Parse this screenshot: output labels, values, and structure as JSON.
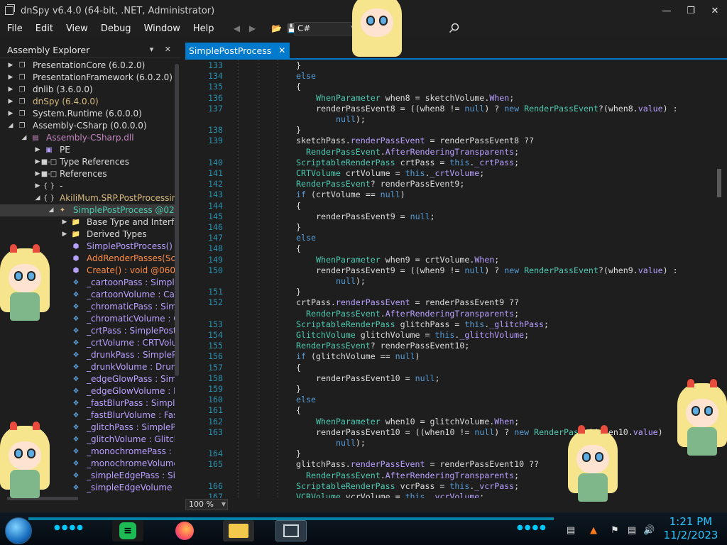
{
  "window": {
    "title": "dnSpy v6.4.0 (64-bit, .NET, Administrator)",
    "controls": [
      "minimize",
      "maximize",
      "close"
    ]
  },
  "menu": [
    "File",
    "Edit",
    "View",
    "Debug",
    "Window",
    "Help"
  ],
  "toolbar": {
    "language": "C#",
    "icons": [
      "back-icon",
      "forward-icon",
      "open-icon",
      "save-icon",
      "search-icon"
    ]
  },
  "explorer": {
    "title": "Assembly Explorer",
    "header_controls": "▾ ✕",
    "tree": [
      {
        "expand": "▶",
        "icon": "assembly",
        "label": "PresentationCore (6.0.2.0)",
        "color": "white",
        "indent": 0
      },
      {
        "expand": "▶",
        "icon": "assembly",
        "label": "PresentationFramework (6.0.2.0)",
        "color": "white",
        "indent": 0
      },
      {
        "expand": "▶",
        "icon": "assembly",
        "label": "dnlib (3.6.0.0)",
        "color": "white",
        "indent": 0
      },
      {
        "expand": "▶",
        "icon": "assembly",
        "label": "dnSpy (6.4.0.0)",
        "color": "yellow",
        "indent": 0
      },
      {
        "expand": "▶",
        "icon": "assembly",
        "label": "System.Runtime (6.0.0.0)",
        "color": "white",
        "indent": 0
      },
      {
        "expand": "◢",
        "icon": "assembly",
        "label": "Assembly-CSharp (0.0.0.0)",
        "color": "white",
        "indent": 0
      },
      {
        "expand": "◢",
        "icon": "module",
        "label": "Assembly-CSharp.dll",
        "color": "violet",
        "indent": 1
      },
      {
        "expand": "▶",
        "icon": "pe",
        "label": "PE",
        "color": "white",
        "indent": 2
      },
      {
        "expand": "▶",
        "icon": "ref",
        "label": "Type References",
        "color": "white",
        "indent": 2
      },
      {
        "expand": "▶",
        "icon": "ref",
        "label": "References",
        "color": "white",
        "indent": 2
      },
      {
        "expand": "▶",
        "icon": "ns",
        "label": "-",
        "color": "white",
        "indent": 2
      },
      {
        "expand": "◢",
        "icon": "ns",
        "label": "AkiliMum.SRP.PostProcessing",
        "color": "yellow",
        "indent": 2
      },
      {
        "expand": "◢",
        "icon": "class",
        "label": "SimplePostProcess @0200",
        "color": "teal",
        "indent": 3,
        "selected": true
      },
      {
        "expand": "▶",
        "icon": "folder",
        "label": "Base Type and Interfac",
        "color": "white",
        "indent": 4
      },
      {
        "expand": "▶",
        "icon": "folder",
        "label": "Derived Types",
        "color": "white",
        "indent": 4
      },
      {
        "expand": "",
        "icon": "method",
        "label": "SimplePostProcess() : v",
        "color": "purple",
        "indent": 4
      },
      {
        "expand": "",
        "icon": "method",
        "label": "AddRenderPasses(Scrip",
        "color": "orange",
        "indent": 4
      },
      {
        "expand": "",
        "icon": "method",
        "label": "Create() : void @06000",
        "color": "orange",
        "indent": 4
      },
      {
        "expand": "",
        "icon": "field",
        "label": "_cartoonPass : SimpleP",
        "color": "purple",
        "indent": 4
      },
      {
        "expand": "",
        "icon": "field",
        "label": "_cartoonVolume : Cart",
        "color": "purple",
        "indent": 4
      },
      {
        "expand": "",
        "icon": "field",
        "label": "_chromaticPass : Simp",
        "color": "purple",
        "indent": 4
      },
      {
        "expand": "",
        "icon": "field",
        "label": "_chromaticVolume : C",
        "color": "purple",
        "indent": 4
      },
      {
        "expand": "",
        "icon": "field",
        "label": "_crtPass : SimplePostP",
        "color": "purple",
        "indent": 4
      },
      {
        "expand": "",
        "icon": "field",
        "label": "_crtVolume : CRTVolun",
        "color": "purple",
        "indent": 4
      },
      {
        "expand": "",
        "icon": "field",
        "label": "_drunkPass : SimplePo",
        "color": "purple",
        "indent": 4
      },
      {
        "expand": "",
        "icon": "field",
        "label": "_drunkVolume : Drunk",
        "color": "purple",
        "indent": 4
      },
      {
        "expand": "",
        "icon": "field",
        "label": "_edgeGlowPass : Simp",
        "color": "purple",
        "indent": 4
      },
      {
        "expand": "",
        "icon": "field",
        "label": "_edgeGlowVolume : Ec",
        "color": "purple",
        "indent": 4
      },
      {
        "expand": "",
        "icon": "field",
        "label": "_fastBlurPass : SimpleP",
        "color": "purple",
        "indent": 4
      },
      {
        "expand": "",
        "icon": "field",
        "label": "_fastBlurVolume : Fastl",
        "color": "purple",
        "indent": 4
      },
      {
        "expand": "",
        "icon": "field",
        "label": "_glitchPass : SimplePo",
        "color": "purple",
        "indent": 4
      },
      {
        "expand": "",
        "icon": "field",
        "label": "_glitchVolume : GlitchV",
        "color": "purple",
        "indent": 4
      },
      {
        "expand": "",
        "icon": "field",
        "label": "_monochromePass : Si",
        "color": "purple",
        "indent": 4
      },
      {
        "expand": "",
        "icon": "field",
        "label": "_monochromeVolume",
        "color": "purple",
        "indent": 4
      },
      {
        "expand": "",
        "icon": "field",
        "label": "_simpleEdgePass : Sim",
        "color": "purple",
        "indent": 4
      },
      {
        "expand": "",
        "icon": "field",
        "label": "_simpleEdgeVolume : ",
        "color": "purple",
        "indent": 4
      }
    ]
  },
  "editor": {
    "tab_label": "SimplePostProcess",
    "zoom": "100 %",
    "lines": [
      {
        "n": "133",
        "i": 0,
        "code": [
          [
            "}",
            "n"
          ]
        ]
      },
      {
        "n": "134",
        "i": 0,
        "code": [
          [
            "else",
            "k"
          ]
        ]
      },
      {
        "n": "135",
        "i": 0,
        "code": [
          [
            "{",
            "n"
          ]
        ]
      },
      {
        "n": "136",
        "i": 1,
        "code": [
          [
            "WhenParameter",
            "t"
          ],
          [
            " when8 = sketchVolume.",
            "n"
          ],
          [
            "When",
            "p"
          ],
          [
            ";",
            "n"
          ]
        ]
      },
      {
        "n": "137",
        "i": 1,
        "code": [
          [
            "renderPassEvent8 = ((when8 != ",
            "n"
          ],
          [
            "null",
            "k"
          ],
          [
            ") ? ",
            "n"
          ],
          [
            "new",
            "k"
          ],
          [
            " ",
            "n"
          ],
          [
            "RenderPassEvent",
            "t"
          ],
          [
            "?(when8.",
            "n"
          ],
          [
            "value",
            "p"
          ],
          [
            ") :",
            "n"
          ]
        ]
      },
      {
        "n": "",
        "i": 2,
        "code": [
          [
            "null",
            "k"
          ],
          [
            ");",
            "n"
          ]
        ]
      },
      {
        "n": "138",
        "i": 0,
        "code": [
          [
            "}",
            "n"
          ]
        ]
      },
      {
        "n": "139",
        "i": 0,
        "code": [
          [
            "sketchPass.",
            "n"
          ],
          [
            "renderPassEvent",
            "p"
          ],
          [
            " = renderPassEvent8 ??",
            "n"
          ]
        ]
      },
      {
        "n": "",
        "i": 0.5,
        "code": [
          [
            "RenderPassEvent",
            "t"
          ],
          [
            ".",
            "n"
          ],
          [
            "AfterRenderingTransparents",
            "p"
          ],
          [
            ";",
            "n"
          ]
        ]
      },
      {
        "n": "140",
        "i": 0,
        "code": [
          [
            "ScriptableRenderPass",
            "t"
          ],
          [
            " crtPass = ",
            "n"
          ],
          [
            "this",
            "k"
          ],
          [
            ".",
            "n"
          ],
          [
            "_crtPass",
            "p"
          ],
          [
            ";",
            "n"
          ]
        ]
      },
      {
        "n": "141",
        "i": 0,
        "code": [
          [
            "CRTVolume",
            "t"
          ],
          [
            " crtVolume = ",
            "n"
          ],
          [
            "this",
            "k"
          ],
          [
            ".",
            "n"
          ],
          [
            "_crtVolume",
            "p"
          ],
          [
            ";",
            "n"
          ]
        ]
      },
      {
        "n": "142",
        "i": 0,
        "code": [
          [
            "RenderPassEvent",
            "t"
          ],
          [
            "? renderPassEvent9;",
            "n"
          ]
        ]
      },
      {
        "n": "143",
        "i": 0,
        "code": [
          [
            "if",
            "k"
          ],
          [
            " (crtVolume == ",
            "n"
          ],
          [
            "null",
            "k"
          ],
          [
            ")",
            "n"
          ]
        ]
      },
      {
        "n": "144",
        "i": 0,
        "code": [
          [
            "{",
            "n"
          ]
        ]
      },
      {
        "n": "145",
        "i": 1,
        "code": [
          [
            "renderPassEvent9 = ",
            "n"
          ],
          [
            "null",
            "k"
          ],
          [
            ";",
            "n"
          ]
        ]
      },
      {
        "n": "146",
        "i": 0,
        "code": [
          [
            "}",
            "n"
          ]
        ]
      },
      {
        "n": "147",
        "i": 0,
        "code": [
          [
            "else",
            "k"
          ]
        ]
      },
      {
        "n": "148",
        "i": 0,
        "code": [
          [
            "{",
            "n"
          ]
        ]
      },
      {
        "n": "149",
        "i": 1,
        "code": [
          [
            "WhenParameter",
            "t"
          ],
          [
            " when9 = crtVolume.",
            "n"
          ],
          [
            "When",
            "p"
          ],
          [
            ";",
            "n"
          ]
        ]
      },
      {
        "n": "150",
        "i": 1,
        "code": [
          [
            "renderPassEvent9 = ((when9 != ",
            "n"
          ],
          [
            "null",
            "k"
          ],
          [
            ") ? ",
            "n"
          ],
          [
            "new",
            "k"
          ],
          [
            " ",
            "n"
          ],
          [
            "RenderPassEvent",
            "t"
          ],
          [
            "?(when9.",
            "n"
          ],
          [
            "value",
            "p"
          ],
          [
            ") :",
            "n"
          ]
        ]
      },
      {
        "n": "",
        "i": 2,
        "code": [
          [
            "null",
            "k"
          ],
          [
            ");",
            "n"
          ]
        ]
      },
      {
        "n": "151",
        "i": 0,
        "code": [
          [
            "}",
            "n"
          ]
        ]
      },
      {
        "n": "152",
        "i": 0,
        "code": [
          [
            "crtPass.",
            "n"
          ],
          [
            "renderPassEvent",
            "p"
          ],
          [
            " = renderPassEvent9 ??",
            "n"
          ]
        ]
      },
      {
        "n": "",
        "i": 0.5,
        "code": [
          [
            "RenderPassEvent",
            "t"
          ],
          [
            ".",
            "n"
          ],
          [
            "AfterRenderingTransparents",
            "p"
          ],
          [
            ";",
            "n"
          ]
        ]
      },
      {
        "n": "153",
        "i": 0,
        "code": [
          [
            "ScriptableRenderPass",
            "t"
          ],
          [
            " glitchPass = ",
            "n"
          ],
          [
            "this",
            "k"
          ],
          [
            ".",
            "n"
          ],
          [
            "_glitchPass",
            "p"
          ],
          [
            ";",
            "n"
          ]
        ]
      },
      {
        "n": "154",
        "i": 0,
        "code": [
          [
            "GlitchVolume",
            "t"
          ],
          [
            " glitchVolume = ",
            "n"
          ],
          [
            "this",
            "k"
          ],
          [
            ".",
            "n"
          ],
          [
            "_glitchVolume",
            "p"
          ],
          [
            ";",
            "n"
          ]
        ]
      },
      {
        "n": "155",
        "i": 0,
        "code": [
          [
            "RenderPassEvent",
            "t"
          ],
          [
            "? renderPassEvent10;",
            "n"
          ]
        ]
      },
      {
        "n": "156",
        "i": 0,
        "code": [
          [
            "if",
            "k"
          ],
          [
            " (glitchVolume == ",
            "n"
          ],
          [
            "null",
            "k"
          ],
          [
            ")",
            "n"
          ]
        ]
      },
      {
        "n": "157",
        "i": 0,
        "code": [
          [
            "{",
            "n"
          ]
        ]
      },
      {
        "n": "158",
        "i": 1,
        "code": [
          [
            "renderPassEvent10 = ",
            "n"
          ],
          [
            "null",
            "k"
          ],
          [
            ";",
            "n"
          ]
        ]
      },
      {
        "n": "159",
        "i": 0,
        "code": [
          [
            "}",
            "n"
          ]
        ]
      },
      {
        "n": "160",
        "i": 0,
        "code": [
          [
            "else",
            "k"
          ]
        ]
      },
      {
        "n": "161",
        "i": 0,
        "code": [
          [
            "{",
            "n"
          ]
        ]
      },
      {
        "n": "162",
        "i": 1,
        "code": [
          [
            "WhenParameter",
            "t"
          ],
          [
            " when10 = glitchVolume.",
            "n"
          ],
          [
            "When",
            "p"
          ],
          [
            ";",
            "n"
          ]
        ]
      },
      {
        "n": "163",
        "i": 1,
        "code": [
          [
            "renderPassEvent10 = ((when10 != ",
            "n"
          ],
          [
            "null",
            "k"
          ],
          [
            ") ? ",
            "n"
          ],
          [
            "new",
            "k"
          ],
          [
            " ",
            "n"
          ],
          [
            "RenderPas",
            "t"
          ],
          [
            "  ?(when10.",
            "n"
          ],
          [
            "value",
            "p"
          ],
          [
            ")",
            "n"
          ]
        ]
      },
      {
        "n": "",
        "i": 2,
        "code": [
          [
            "null",
            "k"
          ],
          [
            ");",
            "n"
          ]
        ]
      },
      {
        "n": "164",
        "i": 0,
        "code": [
          [
            "}",
            "n"
          ]
        ]
      },
      {
        "n": "165",
        "i": 0,
        "code": [
          [
            "glitchPass.",
            "n"
          ],
          [
            "renderPassEvent",
            "p"
          ],
          [
            " = renderPassEvent10 ??",
            "n"
          ]
        ]
      },
      {
        "n": "",
        "i": 0.5,
        "code": [
          [
            "RenderPassEvent",
            "t"
          ],
          [
            ".",
            "n"
          ],
          [
            "AfterRenderingTransparents",
            "p"
          ],
          [
            ";",
            "n"
          ]
        ]
      },
      {
        "n": "166",
        "i": 0,
        "code": [
          [
            "ScriptableRenderPass",
            "t"
          ],
          [
            " vcrPass = ",
            "n"
          ],
          [
            "this",
            "k"
          ],
          [
            ".",
            "n"
          ],
          [
            "_vcrPass",
            "p"
          ],
          [
            ";",
            "n"
          ]
        ]
      },
      {
        "n": "167",
        "i": 0,
        "code": [
          [
            "VCRVolume",
            "t"
          ],
          [
            " vcrVolume = ",
            "n"
          ],
          [
            "this",
            "k"
          ],
          [
            ".",
            "n"
          ],
          [
            "_vcrVolume",
            "p"
          ],
          [
            ";",
            "n"
          ]
        ]
      }
    ]
  },
  "taskbar": {
    "apps": [
      "notes-app",
      "firefox",
      "file-explorer",
      "dnspy"
    ],
    "tray_icons": [
      "network-icon",
      "flag-icon",
      "speaker-icon"
    ],
    "time": "1:21 PM",
    "date": "11/2/2023"
  },
  "colors": {
    "accent": "#007acc",
    "keyword": "#569cd6",
    "type": "#4ec9b0",
    "member": "#b8a0ff",
    "line_number": "#2b91af",
    "clock": "#26c6ff"
  }
}
